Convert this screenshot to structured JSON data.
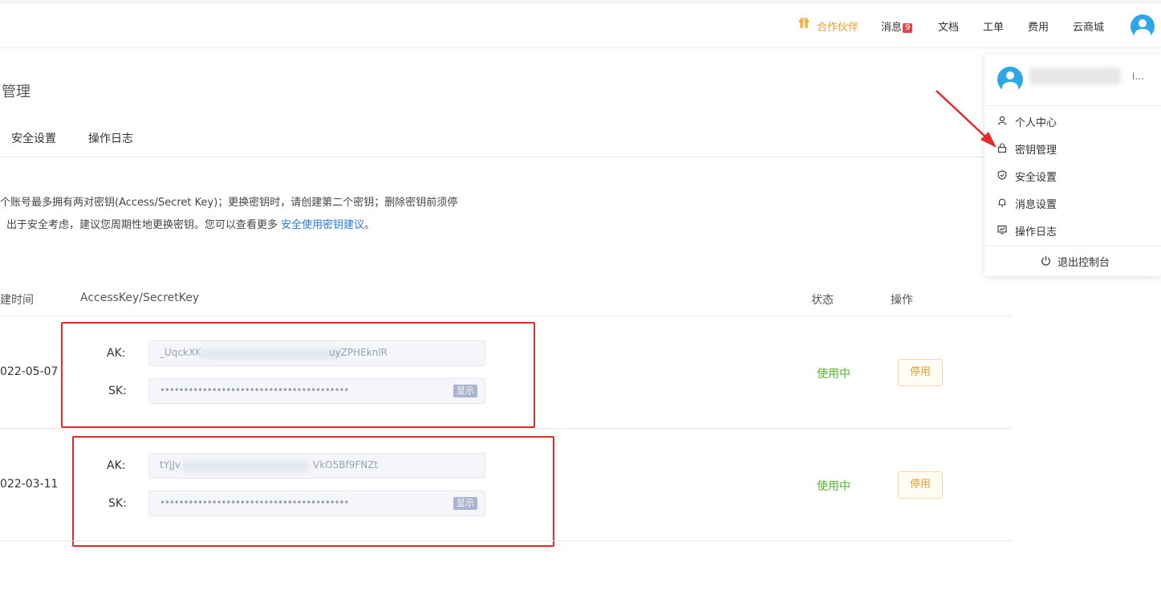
{
  "header": {
    "partner": "合作伙伴",
    "messages": "消息",
    "message_count": "9",
    "docs": "文档",
    "tickets": "工单",
    "billing": "费用",
    "cloud_market": "云商城",
    "partner_color": "#e89b2a",
    "badge_color": "#e0474d"
  },
  "page": {
    "title": "管理",
    "tabs": [
      "安全设置",
      "操作日志"
    ],
    "note_line1": "个账号最多拥有两对密钥(Access/Secret Key)；更换密钥时，请创建第二个密钥；删除密钥前须停",
    "note_line2_prefix": "出于安全考虑，建议您周期性地更换密钥。您可以查看更多",
    "note_link": "安全使用密钥建议",
    "note_line2_suffix": "。",
    "link_color": "#2779d8"
  },
  "table": {
    "columns": [
      "建时间",
      "AccessKey/SecretKey",
      "状态",
      "操作"
    ],
    "ak_label": "AK:",
    "sk_label": "SK:",
    "show_label": "显示",
    "rows": [
      {
        "date": "022-05-07",
        "ak_prefix": "_UqckXK",
        "ak_suffix": "uyZPHEknlR",
        "sk_masked": "••••••••••••••••••••••••••••••••••••••••",
        "status": "使用中",
        "action": "停用"
      },
      {
        "date": "022-03-11",
        "ak_prefix": "tYjJv",
        "ak_suffix": "VkO5Bf9FNZt",
        "sk_masked": "••••••••••••••••••••••••••••••••••••••••",
        "status": "使用中",
        "action": "停用"
      }
    ],
    "status_color": "#52b52a",
    "highlight_color": "#e32b2b"
  },
  "user_menu": {
    "username_tail": "і...",
    "items": [
      {
        "label": "个人中心",
        "icon": "user-icon"
      },
      {
        "label": "密钥管理",
        "icon": "lock-icon"
      },
      {
        "label": "安全设置",
        "icon": "shield-icon"
      },
      {
        "label": "消息设置",
        "icon": "bell-icon"
      },
      {
        "label": "操作日志",
        "icon": "log-icon"
      }
    ],
    "logout": "退出控制台"
  }
}
